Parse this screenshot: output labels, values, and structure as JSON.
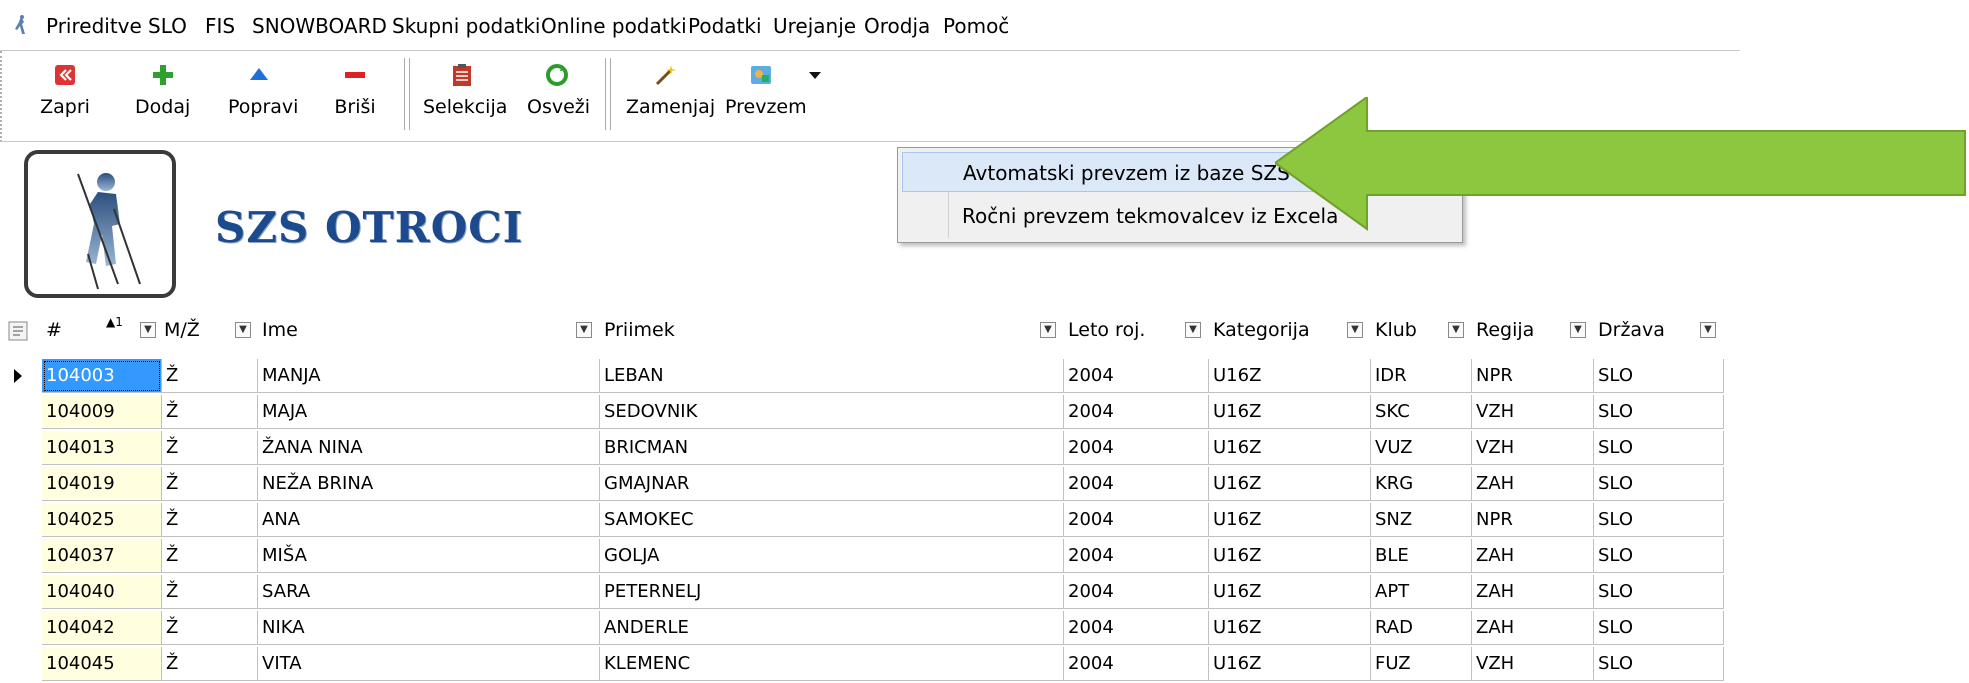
{
  "menu": [
    "Prireditve",
    "SLO",
    "FIS",
    "SNOWBOARD",
    "Skupni podatki",
    "Online podatki",
    "Podatki",
    "Urejanje",
    "Orodja",
    "Pomoč"
  ],
  "toolbar": {
    "close": "Zapri",
    "add": "Dodaj",
    "edit": "Popravi",
    "delete": "Briši",
    "selection": "Selekcija",
    "refresh": "Osveži",
    "replace": "Zamenjaj",
    "import": "Prevzem"
  },
  "header": {
    "title": "SZS OTROCI"
  },
  "dropdown": {
    "items": [
      "Avtomatski prevzem iz baze SZS",
      "Ročni prevzem tekmovalcev iz Excela"
    ]
  },
  "columns": [
    "#",
    "M/Ž",
    "Ime",
    "Priimek",
    "Leto roj.",
    "Kategorija",
    "Klub",
    "Regija",
    "Država"
  ],
  "sort_index": "1",
  "rows": [
    [
      "104003",
      "Ž",
      "MANJA",
      "LEBAN",
      "2004",
      "U16Z",
      "IDR",
      "NPR",
      "SLO"
    ],
    [
      "104009",
      "Ž",
      "MAJA",
      "SEDOVNIK",
      "2004",
      "U16Z",
      "SKC",
      "VZH",
      "SLO"
    ],
    [
      "104013",
      "Ž",
      "ŽANA NINA",
      "BRICMAN",
      "2004",
      "U16Z",
      "VUZ",
      "VZH",
      "SLO"
    ],
    [
      "104019",
      "Ž",
      "NEŽA BRINA",
      "GMAJNAR",
      "2004",
      "U16Z",
      "KRG",
      "ZAH",
      "SLO"
    ],
    [
      "104025",
      "Ž",
      "ANA",
      "SAMOKEC",
      "2004",
      "U16Z",
      "SNZ",
      "NPR",
      "SLO"
    ],
    [
      "104037",
      "Ž",
      "MIŠA",
      "GOLJA",
      "2004",
      "U16Z",
      "BLE",
      "ZAH",
      "SLO"
    ],
    [
      "104040",
      "Ž",
      "SARA",
      "PETERNELJ",
      "2004",
      "U16Z",
      "APT",
      "ZAH",
      "SLO"
    ],
    [
      "104042",
      "Ž",
      "NIKA",
      "ANDERLE",
      "2004",
      "U16Z",
      "RAD",
      "ZAH",
      "SLO"
    ],
    [
      "104045",
      "Ž",
      "VITA",
      "KLEMENC",
      "2004",
      "U16Z",
      "FUZ",
      "VZH",
      "SLO"
    ]
  ],
  "colors": {
    "accent_arrow": "#8dc63f",
    "title": "#1d4a8c",
    "selection": "#3399ff"
  }
}
